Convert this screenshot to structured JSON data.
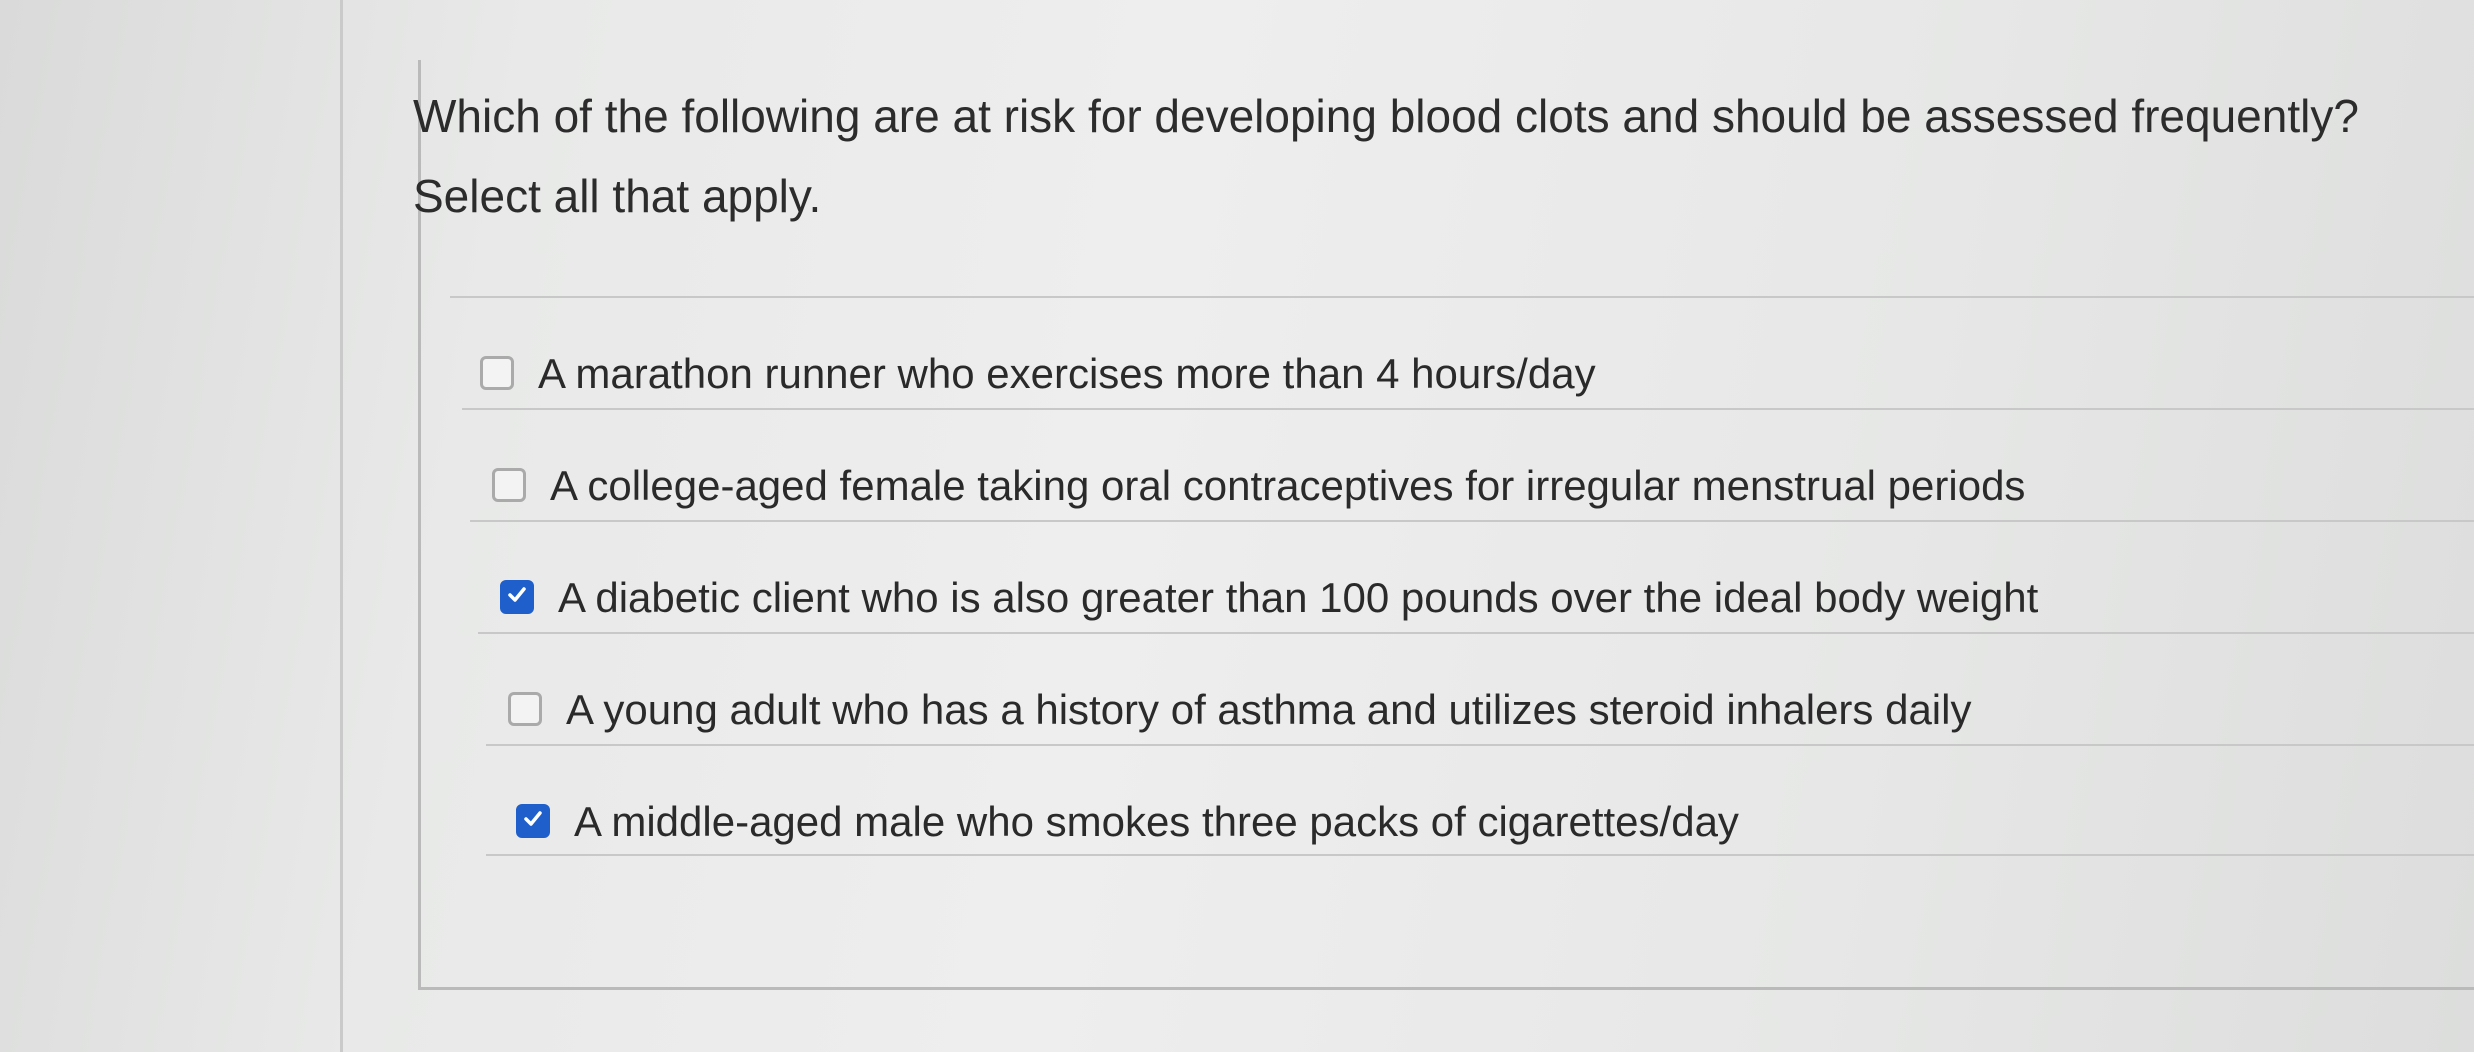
{
  "question": {
    "text": "Which of the following are at risk for developing blood clots and should be assessed frequently? Select all that apply."
  },
  "options": [
    {
      "label": "A marathon runner who exercises more than 4 hours/day",
      "checked": false
    },
    {
      "label": "A college-aged female taking oral contraceptives for irregular menstrual periods",
      "checked": false
    },
    {
      "label": "A diabetic client who is also greater than 100 pounds over the ideal body weight",
      "checked": true
    },
    {
      "label": "A young adult who has a history of asthma and utilizes steroid inhalers daily",
      "checked": false
    },
    {
      "label": "A middle-aged male who smokes three packs of cigarettes/day",
      "checked": true
    }
  ],
  "colors": {
    "checkbox_checked": "#1f5fcc",
    "checkbox_unchecked_border": "#a9aaa9",
    "text": "#2a2a2a"
  }
}
